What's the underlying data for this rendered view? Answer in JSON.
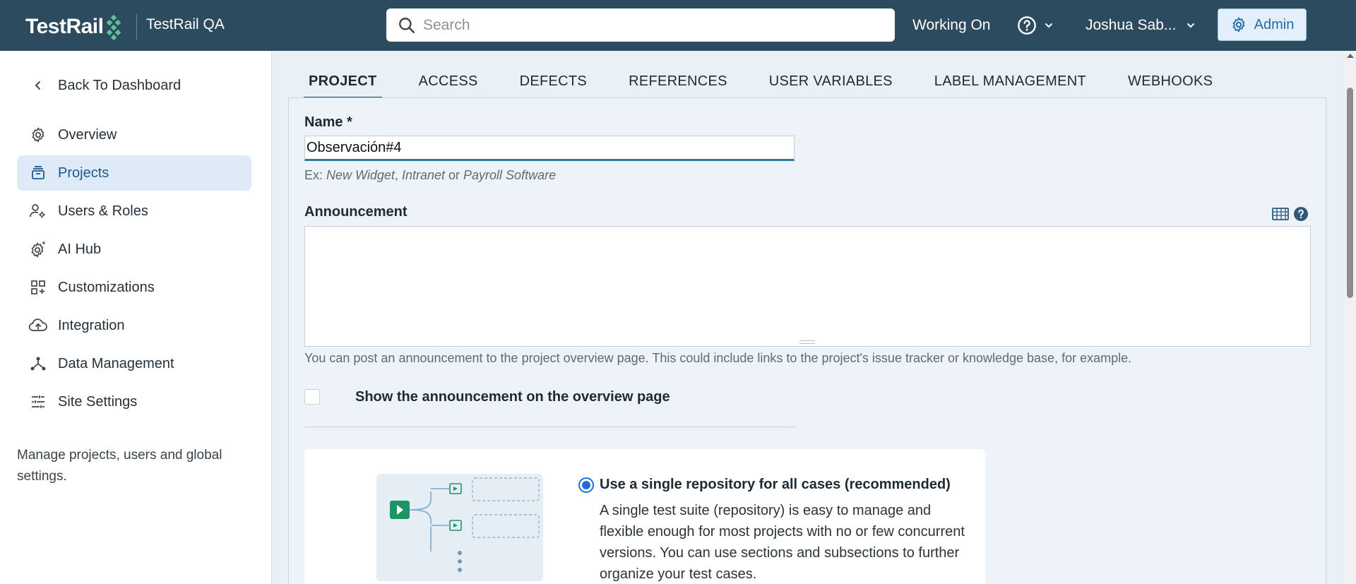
{
  "header": {
    "logo_text": "TestRail",
    "instance_name": "TestRail QA",
    "search_placeholder": "Search",
    "working_on": "Working On",
    "user_name": "Joshua Sab...",
    "admin_label": "Admin"
  },
  "sidebar": {
    "back_label": "Back To Dashboard",
    "items": [
      {
        "label": "Overview",
        "icon": "gear-icon"
      },
      {
        "label": "Projects",
        "icon": "projects-icon"
      },
      {
        "label": "Users & Roles",
        "icon": "users-roles-icon"
      },
      {
        "label": "AI Hub",
        "icon": "ai-hub-icon"
      },
      {
        "label": "Customizations",
        "icon": "customizations-icon"
      },
      {
        "label": "Integration",
        "icon": "cloud-upload-icon"
      },
      {
        "label": "Data Management",
        "icon": "data-management-icon"
      },
      {
        "label": "Site Settings",
        "icon": "sliders-icon"
      }
    ],
    "active_item": "Projects",
    "description": "Manage projects, users and global settings."
  },
  "tabs": [
    "PROJECT",
    "ACCESS",
    "DEFECTS",
    "REFERENCES",
    "USER VARIABLES",
    "LABEL MANAGEMENT",
    "WEBHOOKS"
  ],
  "active_tab": "PROJECT",
  "form": {
    "name_label": "Name *",
    "name_value": "Observación#4",
    "name_hint_prefix": "Ex:",
    "name_hint_ex1": "New Widget",
    "name_hint_sep": ",",
    "name_hint_ex2": "Intranet",
    "name_hint_or": "or",
    "name_hint_ex3": "Payroll Software",
    "announcement_label": "Announcement",
    "announcement_value": "",
    "announcement_hint": "You can post an announcement to the project overview page. This could include links to the project's issue tracker or knowledge base, for example.",
    "show_announcement_label": "Show the announcement on the overview page",
    "show_announcement_checked": false
  },
  "repository": {
    "option_title": "Use a single repository for all cases (recommended)",
    "option_selected": true,
    "option_desc": "A single test suite (repository) is easy to manage and flexible enough for most projects with no or few concurrent versions. You can use sections and subsections to further organize your test cases."
  },
  "colors": {
    "header_bg": "#2d4b5e",
    "accent": "#1f6fd1",
    "sidebar_active_bg": "#deeaf7",
    "logo_green": "#5fc29a"
  }
}
